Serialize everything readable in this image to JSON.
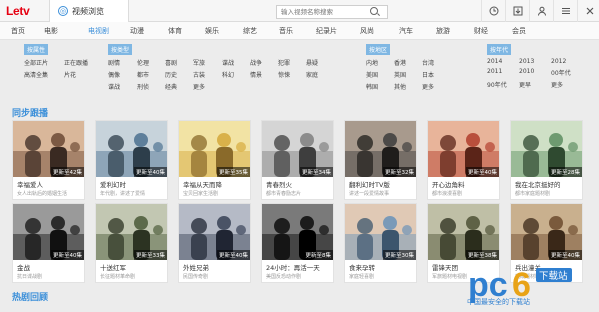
{
  "app": {
    "logo": "Letv",
    "tab_label": "视频浏览"
  },
  "search": {
    "placeholder": "输入视频名称搜索"
  },
  "nav": [
    "首页",
    "电影",
    "电视剧",
    "动漫",
    "体育",
    "娱乐",
    "综艺",
    "音乐",
    "纪录片",
    "风尚",
    "汽车",
    "旅游",
    "财经",
    "会员"
  ],
  "nav_active_index": 2,
  "filters": {
    "attr": {
      "label": "按属性",
      "items": [
        "全部正片",
        "正在跟播",
        "高清全集",
        "片花"
      ]
    },
    "type": {
      "label": "按类型",
      "items": [
        "剧情",
        "伦理",
        "喜剧",
        "军旅",
        "谍战",
        "战争",
        "犯罪",
        "悬疑",
        "偶像",
        "都市",
        "历史",
        "古装",
        "科幻",
        "情景",
        "惊悚",
        "家庭",
        "谍战",
        "刑侦",
        "经典",
        "更多"
      ]
    },
    "region": {
      "label": "按地区",
      "items": [
        "内地",
        "香港",
        "台湾",
        "美国",
        "英国",
        "日本",
        "韩国",
        "其他",
        "更多"
      ]
    },
    "year": {
      "label": "按年代",
      "items": [
        "2014",
        "2013",
        "2012",
        "2011",
        "2010",
        "00年代",
        "90年代",
        "更早",
        "更多"
      ]
    }
  },
  "sections": {
    "sync": "同步跟播",
    "hot": "热剧回顾"
  },
  "cards": [
    {
      "title": "幸福爱人",
      "desc": "女人出轨后的婚姻生活",
      "update": "更新至42集",
      "palette": [
        "#7c5a44",
        "#d9b79a",
        "#3a2a22"
      ]
    },
    {
      "title": "爱利幻时",
      "desc": "年代剧，讲述了爱情",
      "update": "更新至40集",
      "palette": [
        "#5e7f9b",
        "#c7d3db",
        "#2d3e4b"
      ]
    },
    {
      "title": "幸福从天而降",
      "desc": "宝贝回家生活剧",
      "update": "更新至35集",
      "palette": [
        "#d9b14a",
        "#f2e3a4",
        "#8a6a2a"
      ]
    },
    {
      "title": "青春烈火",
      "desc": "都市青春励志片",
      "update": "更新至34集",
      "palette": [
        "#8c8c8c",
        "#d5d5d5",
        "#3e3e3e"
      ]
    },
    {
      "title": "翻利幻时TV版",
      "desc": "讲述一段爱情故事",
      "update": "更新至32集",
      "palette": [
        "#4c4a48",
        "#a89a8d",
        "#1f1d1b"
      ]
    },
    {
      "title": "开心边角料",
      "desc": "都市浪漫喜剧",
      "update": "更新至40集",
      "palette": [
        "#b94f3c",
        "#e8b49a",
        "#5b2418"
      ]
    },
    {
      "title": "我在北京挺好的",
      "desc": "都市家庭题材剧",
      "update": "更新至28集",
      "palette": [
        "#6e9a70",
        "#cfe0c6",
        "#2f4a30"
      ]
    },
    {
      "title": "金战",
      "desc": "抗日谍战剧",
      "update": "更新至40集",
      "palette": [
        "#2b2b2b",
        "#9a9a9a",
        "#111111"
      ]
    },
    {
      "title": "十送红军",
      "desc": "长征题材革命剧",
      "update": "更新至33集",
      "palette": [
        "#5c6a4a",
        "#c2c7b2",
        "#2c3322"
      ]
    },
    {
      "title": "外姓兄弟",
      "desc": "民国传奇剧",
      "update": "更新至40集",
      "palette": [
        "#4a5366",
        "#b5bac6",
        "#202533"
      ]
    },
    {
      "title": "24小时：再活一天",
      "desc": "美国反恐动作剧",
      "update": "更新至8集",
      "palette": [
        "#1c1c1c",
        "#7a7a7a",
        "#000000"
      ]
    },
    {
      "title": "食来孕转",
      "desc": "家庭轻喜剧",
      "update": "更新至30集",
      "palette": [
        "#7a9ab8",
        "#e0c9b5",
        "#3c556d"
      ]
    },
    {
      "title": "雷锋天团",
      "desc": "军旅题材电视剧",
      "update": "更新至38集",
      "palette": [
        "#5f6246",
        "#bfbfa6",
        "#2b2d1c"
      ]
    },
    {
      "title": "兵出潼关",
      "desc": "抗战题材剧",
      "update": "更新至40集",
      "palette": [
        "#7a5a3c",
        "#c9b08e",
        "#3a2818"
      ]
    }
  ],
  "watermark": {
    "logo": "pc6",
    "tag": "下载站",
    "slogan": "中国最安全的下载站"
  },
  "colors": {
    "accent": "#3b8fd9",
    "brand": "#e60012",
    "filter_head": "#7fb7e3"
  }
}
